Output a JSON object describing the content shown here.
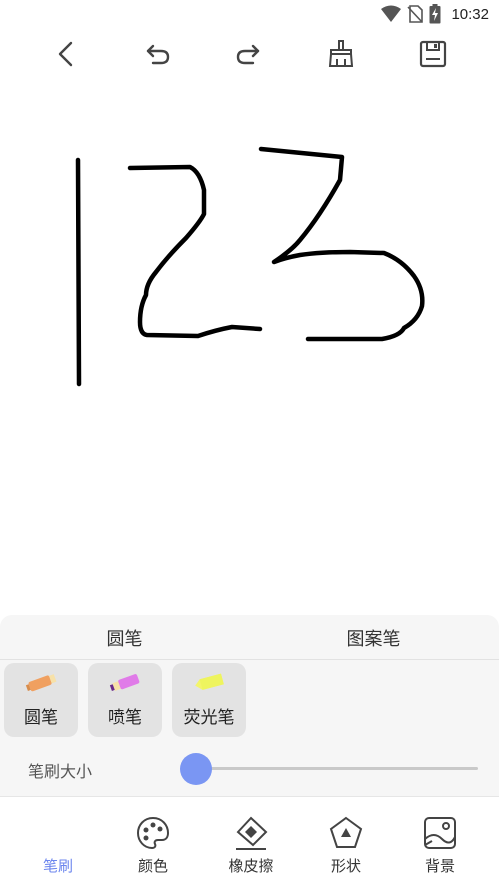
{
  "status_bar": {
    "time": "10:32",
    "icons": [
      "wifi-icon",
      "no-sim-icon",
      "battery-charging-icon"
    ]
  },
  "toolbar": {
    "buttons": [
      "back-icon",
      "undo-icon",
      "redo-icon",
      "clear-brush-icon",
      "save-icon"
    ]
  },
  "canvas": {
    "stroke_color": "#000000",
    "background": "#ffffff"
  },
  "pen_tabs": {
    "round_pen": "圆笔",
    "pattern_pen": "图案笔"
  },
  "pen_options": [
    {
      "label": "圆笔",
      "icon": "round-pen-icon",
      "color": "#f0a060"
    },
    {
      "label": "喷笔",
      "icon": "spray-pen-icon",
      "color": "#e07be8"
    },
    {
      "label": "荧光笔",
      "icon": "highlighter-icon",
      "color": "#f3f56a"
    }
  ],
  "brush_size": {
    "label": "笔刷大小",
    "value": 0
  },
  "accent_color": "#6c86ee",
  "nav": [
    {
      "label": "笔刷",
      "icon": "brush-icon",
      "active": true
    },
    {
      "label": "颜色",
      "icon": "palette-icon",
      "active": false
    },
    {
      "label": "橡皮擦",
      "icon": "eraser-icon",
      "active": false
    },
    {
      "label": "形状",
      "icon": "shape-icon",
      "active": false
    },
    {
      "label": "背景",
      "icon": "background-image-icon",
      "active": false
    }
  ]
}
